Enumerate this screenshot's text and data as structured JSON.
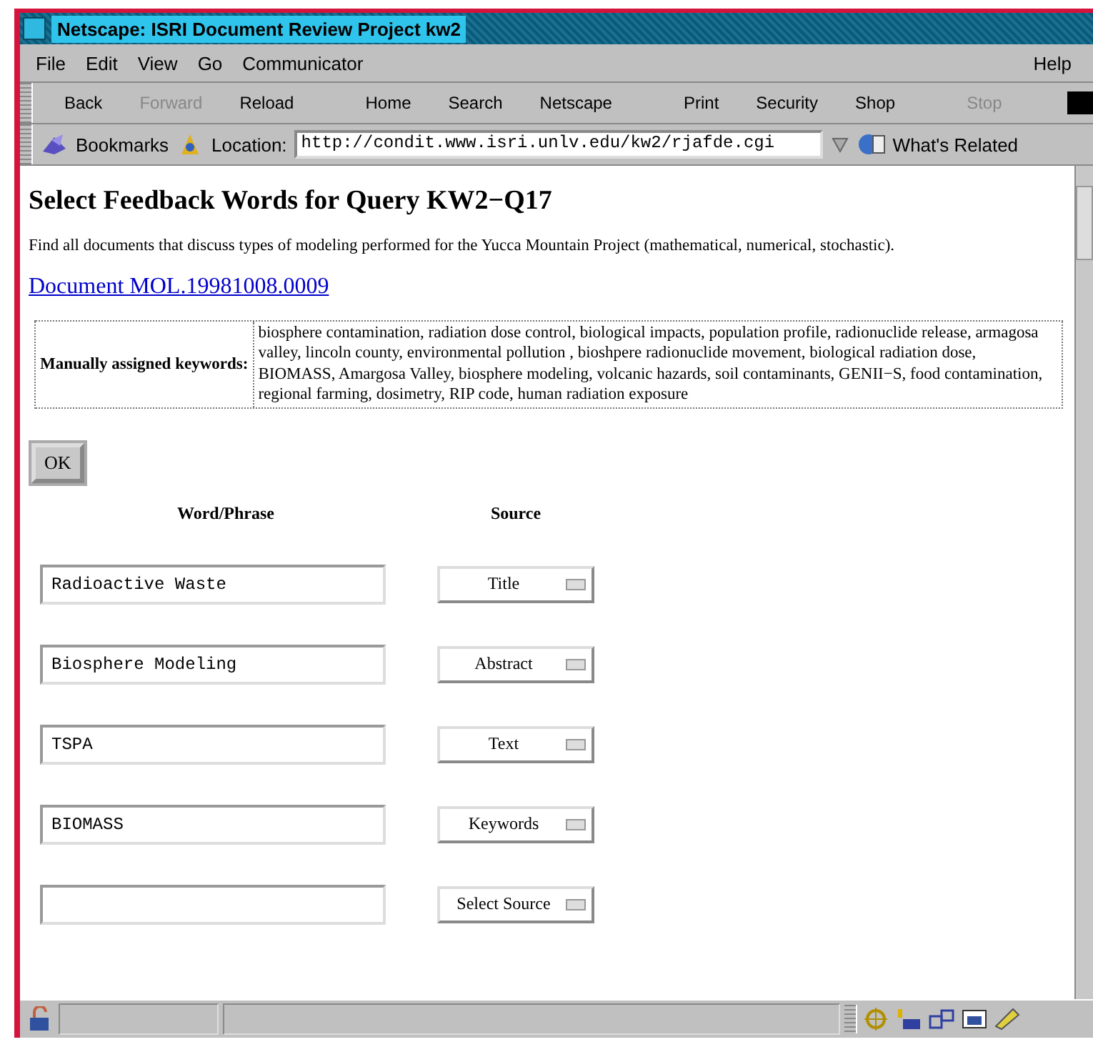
{
  "window": {
    "title": "Netscape: ISRI Document Review Project kw2"
  },
  "menu": [
    "File",
    "Edit",
    "View",
    "Go",
    "Communicator"
  ],
  "menu_help": "Help",
  "toolbar": [
    {
      "label": "Back",
      "disabled": false
    },
    {
      "label": "Forward",
      "disabled": true
    },
    {
      "label": "Reload",
      "disabled": false
    },
    {
      "label": "Home",
      "disabled": false
    },
    {
      "label": "Search",
      "disabled": false
    },
    {
      "label": "Netscape",
      "disabled": false
    },
    {
      "label": "Print",
      "disabled": false
    },
    {
      "label": "Security",
      "disabled": false
    },
    {
      "label": "Shop",
      "disabled": false
    },
    {
      "label": "Stop",
      "disabled": true
    }
  ],
  "location_bar": {
    "bookmarks": "Bookmarks",
    "label": "Location:",
    "url": "http://condit.www.isri.unlv.edu/kw2/rjafde.cgi",
    "whats_related": "What's Related"
  },
  "page": {
    "heading": "Select Feedback Words for Query KW2−Q17",
    "query": "Find all documents that discuss types of modeling performed for the Yucca Mountain Project (mathematical, numerical, stochastic).",
    "document_link": "Document MOL.19981008.0009",
    "keywords_label": "Manually assigned keywords:",
    "keywords": "biosphere contamination, radiation dose control, biological impacts, population profile, radionuclide release, armagosa valley, lincoln county, environmental pollution , bioshpere radionuclide movement, biological radiation dose, BIOMASS, Amargosa Valley, biosphere modeling, volcanic hazards, soil contaminants, GENII−S, food contamination, regional farming, dosimetry, RIP code, human radiation exposure",
    "ok": "OK",
    "columns": [
      "Word/Phrase",
      "Source"
    ],
    "rows": [
      {
        "value": "Radioactive Waste",
        "source": "Title"
      },
      {
        "value": "Biosphere Modeling",
        "source": "Abstract"
      },
      {
        "value": "TSPA",
        "source": "Text"
      },
      {
        "value": "BIOMASS",
        "source": "Keywords"
      },
      {
        "source": "Select Source"
      }
    ]
  }
}
